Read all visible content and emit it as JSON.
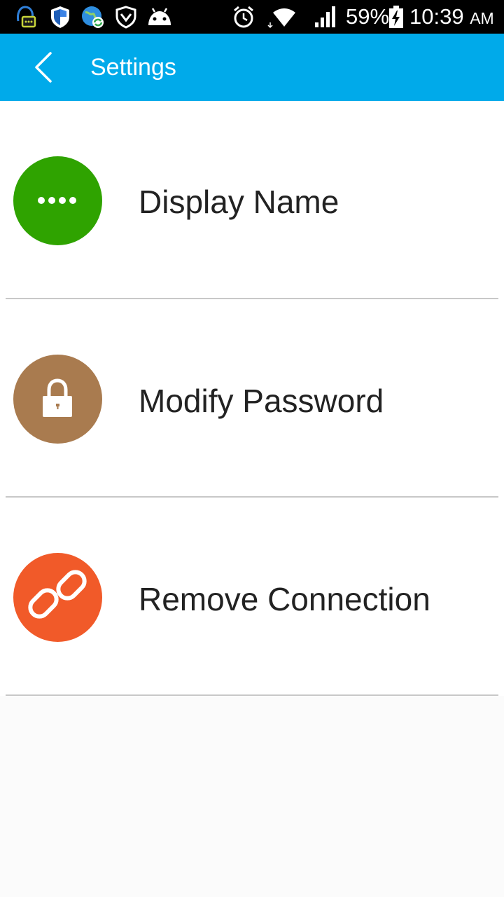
{
  "status_bar": {
    "battery": "59%",
    "time": "10:39",
    "ampm": "AM",
    "notification_icons": [
      "chat-bubble-icon",
      "shield-icon",
      "globe-sync-icon",
      "vpn-shield-icon",
      "android-icon"
    ],
    "system_icons": [
      "alarm-icon",
      "wifi-icon",
      "signal-icon",
      "battery-charging-icon"
    ]
  },
  "app_bar": {
    "title": "Settings",
    "back_icon": "chevron-left-icon",
    "color": "#00aaea"
  },
  "settings": {
    "items": [
      {
        "label": "Display Name",
        "icon": "dots-icon",
        "color": "#2fa300"
      },
      {
        "label": "Modify Password",
        "icon": "lock-icon",
        "color": "#a97b4f"
      },
      {
        "label": "Remove Connection",
        "icon": "link-icon",
        "color": "#f15a29"
      }
    ]
  }
}
